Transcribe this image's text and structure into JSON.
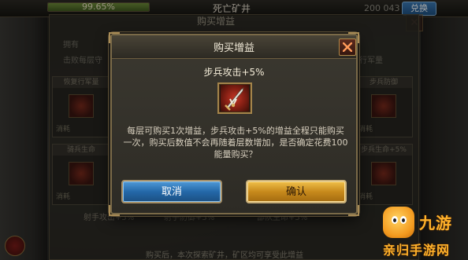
{
  "topbar": {
    "progress_text": "99.65%",
    "progress_value": 99.65,
    "mine_title": "死亡矿井",
    "currency": "200 043",
    "exchange_label": "兑换"
  },
  "background_panel": {
    "title": "购买增益",
    "owned_label": "拥有",
    "line_left": "击败每层守",
    "line_right": "复行军量",
    "cards": [
      {
        "header": "恢复行军量",
        "cost": "消耗"
      },
      {
        "header": "步兵防御",
        "cost": "消耗"
      },
      {
        "header": "骑兵生命",
        "cost": "消耗"
      },
      {
        "header": "步兵生命+5%",
        "cost": "消耗"
      }
    ],
    "bottom_tabs": [
      "射手攻击+5%",
      "射手防御+5%",
      "部队生命+5%"
    ],
    "footer_note": "购买后，本次探索矿井，矿区均可享受此增益"
  },
  "dialog": {
    "title": "购买增益",
    "item_name": "步兵攻击+5%",
    "item_icon": "infantry-attack-icon",
    "description": "每层可购买1次增益，步兵攻击+5%的增益全程只能购买一次，购买后数值不会再随着层数增加，是否确定花费100能量购买？",
    "cancel_label": "取消",
    "confirm_label": "确认"
  },
  "watermark": {
    "line1": "九游",
    "line2": "亲归手游网"
  },
  "colors": {
    "accent_gold": "#a98c56",
    "cancel_blue": "#2468a8",
    "confirm_gold": "#c78a1c"
  }
}
